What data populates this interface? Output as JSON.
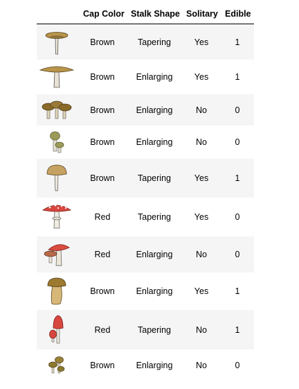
{
  "columns": [
    "Cap Color",
    "Stalk Shape",
    "Solitary",
    "Edible"
  ],
  "rows": [
    {
      "image": "mushroom-tall-tan-icon",
      "cap_color": "Brown",
      "stalk_shape": "Tapering",
      "solitary": "Yes",
      "edible": "1"
    },
    {
      "image": "mushroom-flat-tan-icon",
      "cap_color": "Brown",
      "stalk_shape": "Enlarging",
      "solitary": "Yes",
      "edible": "1"
    },
    {
      "image": "mushroom-cluster-brown-icon",
      "cap_color": "Brown",
      "stalk_shape": "Enlarging",
      "solitary": "No",
      "edible": "0"
    },
    {
      "image": "mushroom-pair-olive-icon",
      "cap_color": "Brown",
      "stalk_shape": "Enlarging",
      "solitary": "No",
      "edible": "0"
    },
    {
      "image": "mushroom-dome-tan-icon",
      "cap_color": "Brown",
      "stalk_shape": "Tapering",
      "solitary": "Yes",
      "edible": "1"
    },
    {
      "image": "mushroom-fly-agaric-icon",
      "cap_color": "Red",
      "stalk_shape": "Tapering",
      "solitary": "Yes",
      "edible": "0"
    },
    {
      "image": "mushroom-pair-red-icon",
      "cap_color": "Red",
      "stalk_shape": "Enlarging",
      "solitary": "No",
      "edible": "0"
    },
    {
      "image": "mushroom-bolete-icon",
      "cap_color": "Brown",
      "stalk_shape": "Enlarging",
      "solitary": "Yes",
      "edible": "1"
    },
    {
      "image": "mushroom-red-conical-icon",
      "cap_color": "Red",
      "stalk_shape": "Tapering",
      "solitary": "No",
      "edible": "1"
    },
    {
      "image": "mushroom-small-cluster-icon",
      "cap_color": "Brown",
      "stalk_shape": "Enlarging",
      "solitary": "No",
      "edible": "0"
    }
  ]
}
